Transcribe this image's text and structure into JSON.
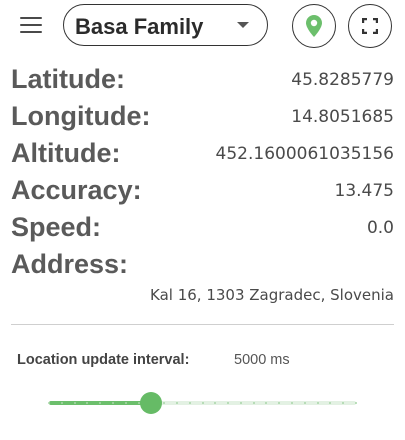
{
  "header": {
    "family_select": {
      "value": "Basa Family"
    },
    "pin_button_icon": "map-pin-icon",
    "expand_button_icon": "fullscreen-icon",
    "accent_color": "#6cbf6c"
  },
  "location": {
    "latitude": {
      "label": "Latitude:",
      "value": "45.8285779"
    },
    "longitude": {
      "label": "Longitude:",
      "value": "14.8051685"
    },
    "altitude": {
      "label": "Altitude:",
      "value": "452.1600061035156"
    },
    "accuracy": {
      "label": "Accuracy:",
      "value": "13.475"
    },
    "speed": {
      "label": "Speed:",
      "value": "0.0"
    },
    "address": {
      "label": "Address:",
      "value": "Kal 16, 1303 Zagradec, Slovenia"
    }
  },
  "interval": {
    "label": "Location update interval:",
    "value": "5000 ms",
    "slider_fraction": 0.333,
    "tick_count": 24
  }
}
